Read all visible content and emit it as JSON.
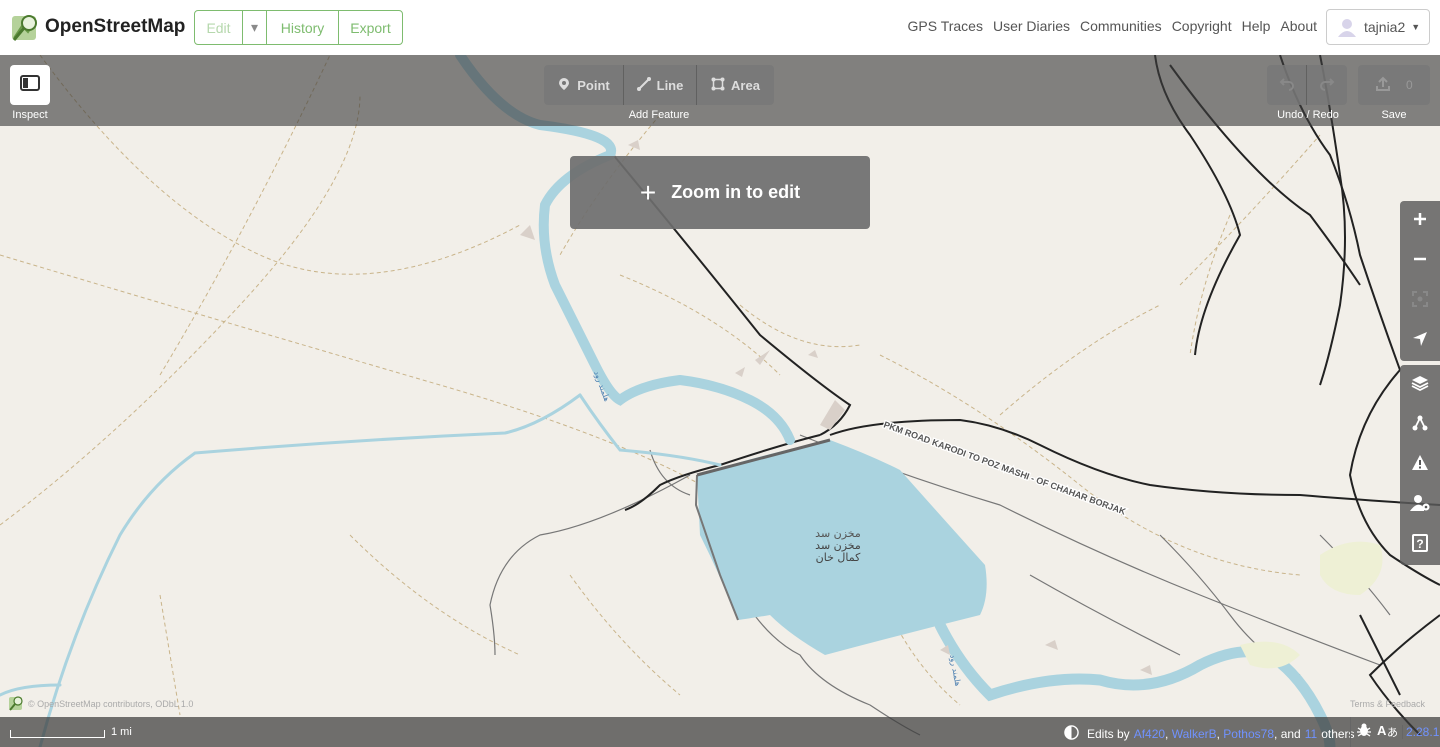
{
  "header": {
    "site_name": "OpenStreetMap",
    "edit_label": "Edit",
    "history_label": "History",
    "export_label": "Export",
    "nav": [
      "GPS Traces",
      "User Diaries",
      "Communities",
      "Copyright",
      "Help",
      "About"
    ],
    "username": "tajnia2"
  },
  "toolbar": {
    "inspect_label": "Inspect",
    "add_feature_label": "Add Feature",
    "point_label": "Point",
    "line_label": "Line",
    "area_label": "Area",
    "undo_redo_label": "Undo / Redo",
    "save_label": "Save",
    "save_count": "0"
  },
  "notice": {
    "zoom_in": "Zoom in to edit"
  },
  "map_labels": {
    "road": "PKM ROAD KARODI TO POZ MASHI - OF CHAHAR BORJAK",
    "reservoir_line1": "مخزن سد",
    "reservoir_line2": "مخزن سد",
    "reservoir_line3": "کمال خان",
    "river1": "هلمند رود",
    "river2": "هلمند رود"
  },
  "footer": {
    "scale_label": "1 mi",
    "attribution": "© OpenStreetMap contributors, ODbL 1.0",
    "terms": "Terms & Feedback",
    "edits_by_prefix": "Edits by",
    "editors": [
      "Af420",
      "WalkerB",
      "Pothos78"
    ],
    "and_label": "and",
    "others_count": "11",
    "others_label": "others",
    "version": "2.28.1"
  },
  "icons": {
    "inspect": "sidebar-toggle-icon",
    "point": "map-pin-icon",
    "line": "line-icon",
    "area": "area-icon",
    "undo": "undo-icon",
    "redo": "redo-icon",
    "save": "upload-icon",
    "zoom_in": "plus-icon",
    "zoom_out": "minus-icon",
    "zoom_to_selection": "focus-icon",
    "geolocate": "location-arrow-icon",
    "background": "layers-icon",
    "map_data": "map-data-icon",
    "issues": "warning-icon",
    "preferences": "user-settings-icon",
    "help": "help-icon"
  },
  "colors": {
    "osm_green": "#7ebc6f",
    "map_bg": "#f2efe9",
    "water": "#aad3df",
    "link_blue": "#7092ff"
  }
}
